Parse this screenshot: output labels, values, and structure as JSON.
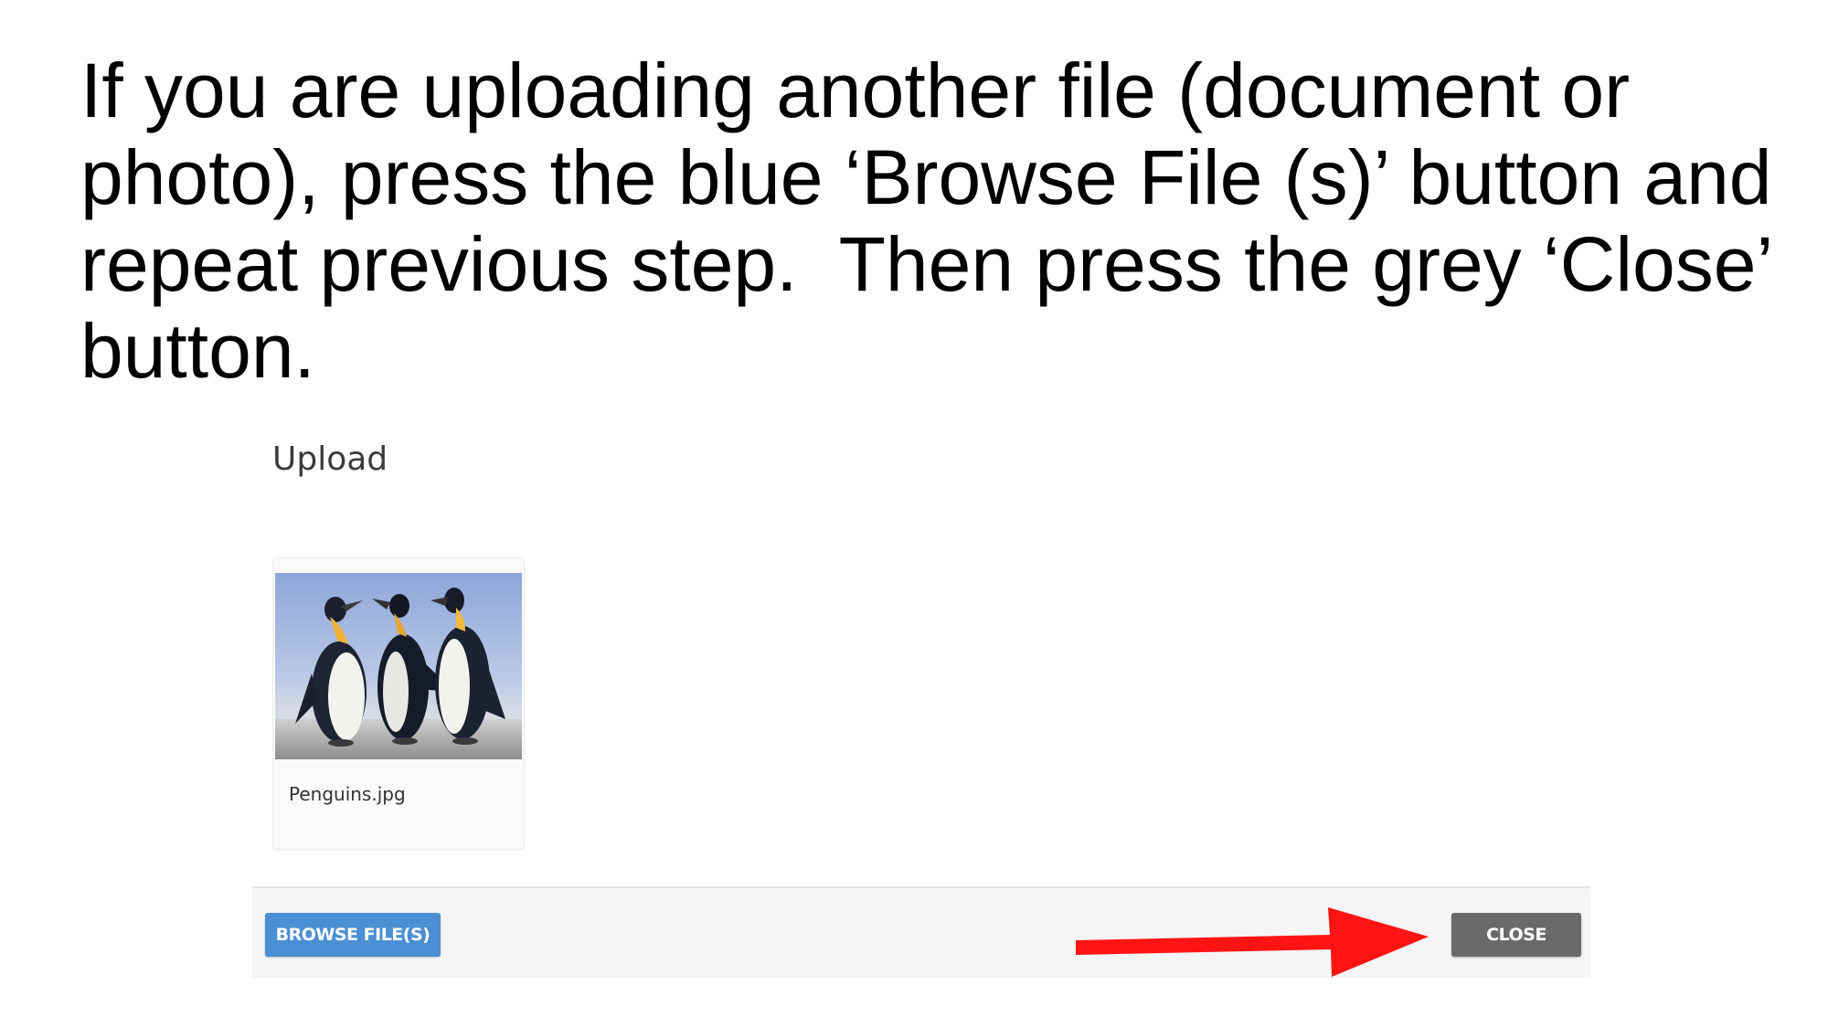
{
  "instruction": {
    "lines": [
      "If you are uploading another file (document or",
      "photo), press the blue ‘Browse File (s)’ button and",
      "repeat previous step.  Then press the grey ‘Close’",
      "button."
    ]
  },
  "dialog": {
    "title": "Upload",
    "files": [
      {
        "name": "Penguins.jpg",
        "thumbnail": "penguins-photo"
      }
    ],
    "footer": {
      "browse_label": "BROWSE FILE(S)",
      "close_label": "CLOSE"
    }
  },
  "annotation": {
    "arrow_color": "#ff1414",
    "points_to": "close-button"
  },
  "colors": {
    "browse_button": "#4a8fd3",
    "close_button": "#6a6a6a",
    "footer_background": "#f5f5f5"
  }
}
